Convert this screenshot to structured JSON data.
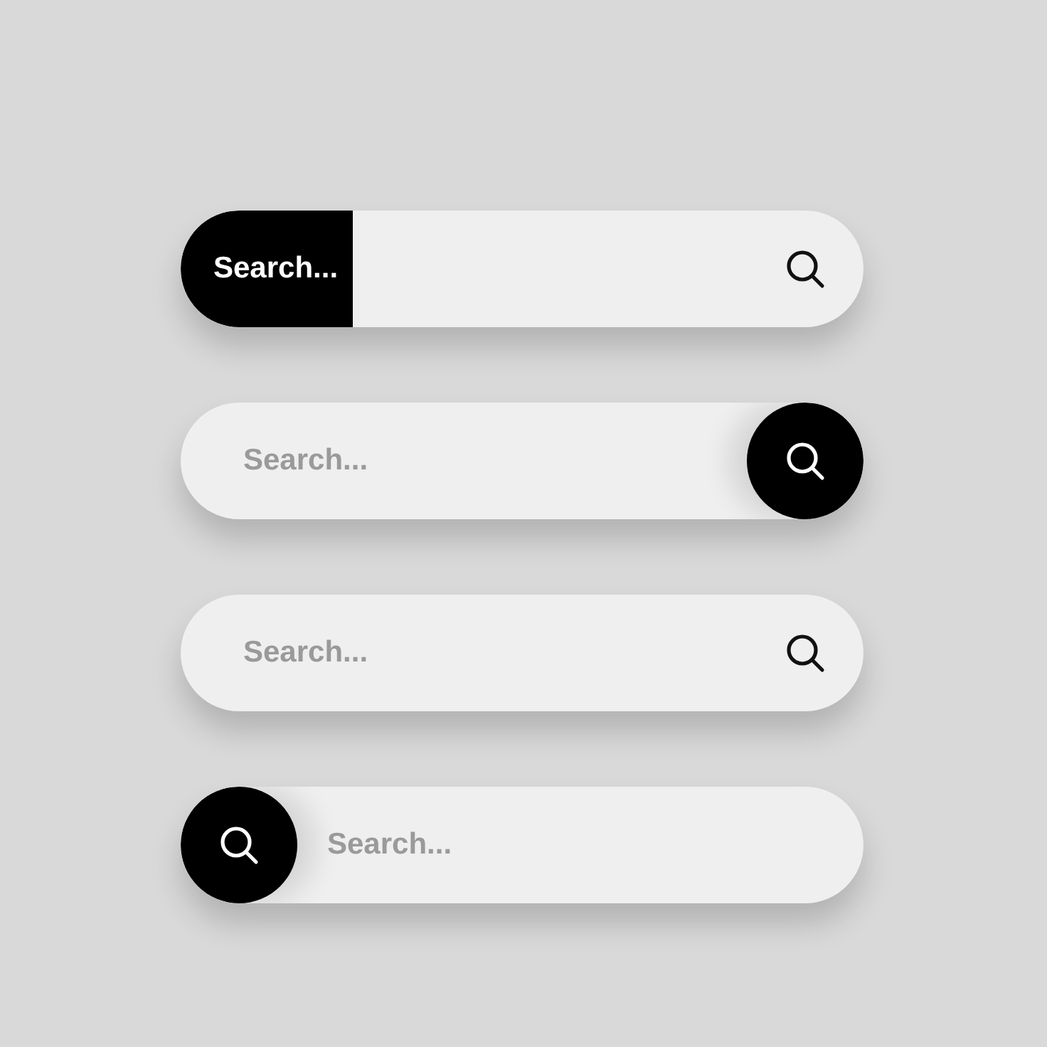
{
  "search_bars": [
    {
      "kind": "label_block",
      "label": "Search..."
    },
    {
      "kind": "button_right",
      "placeholder": "Search..."
    },
    {
      "kind": "plain",
      "placeholder": "Search..."
    },
    {
      "kind": "button_left",
      "placeholder": "Search..."
    }
  ]
}
